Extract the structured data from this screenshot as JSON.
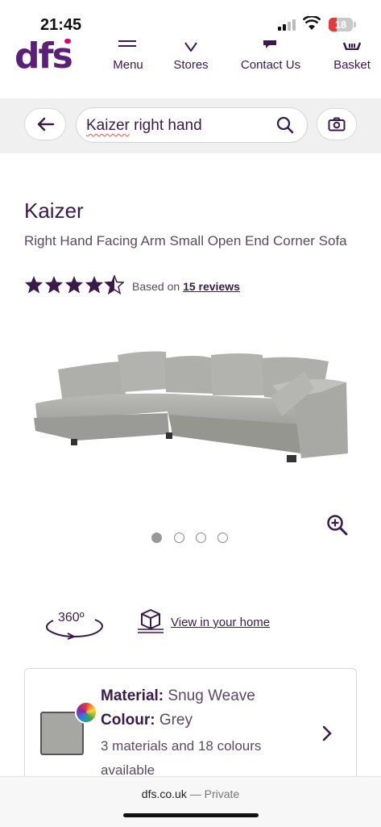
{
  "status": {
    "time": "21:45",
    "battery": "18"
  },
  "header": {
    "logo": "dfs",
    "nav": [
      {
        "label": "Menu",
        "icon": "hamburger-icon"
      },
      {
        "label": "Stores",
        "icon": "location-icon"
      },
      {
        "label": "Contact Us",
        "icon": "chat-icon"
      },
      {
        "label": "Basket",
        "icon": "basket-icon"
      }
    ]
  },
  "search": {
    "value_misspelled": "Kaizer",
    "value_rest": " right hand"
  },
  "product": {
    "title": "Kaizer",
    "subtitle": "Right Hand Facing Arm Small Open End Corner Sofa",
    "rating": 4.5,
    "reviews_prefix": "Based on",
    "reviews_link": "15 reviews",
    "image_count": 4,
    "active_image": 1,
    "three60_label": "360º",
    "view_home": "View in your home"
  },
  "options": {
    "material_label": "Material:",
    "material_value": "Snug Weave",
    "colour_label": "Colour:",
    "colour_value": "Grey",
    "more": "3 materials and 18 colours available"
  },
  "browser": {
    "domain": "dfs.co.uk",
    "mode": " — Private"
  },
  "colors": {
    "brand": "#5b1f7a",
    "text": "#3a1a4a",
    "swatch": "#a6a7a2"
  }
}
